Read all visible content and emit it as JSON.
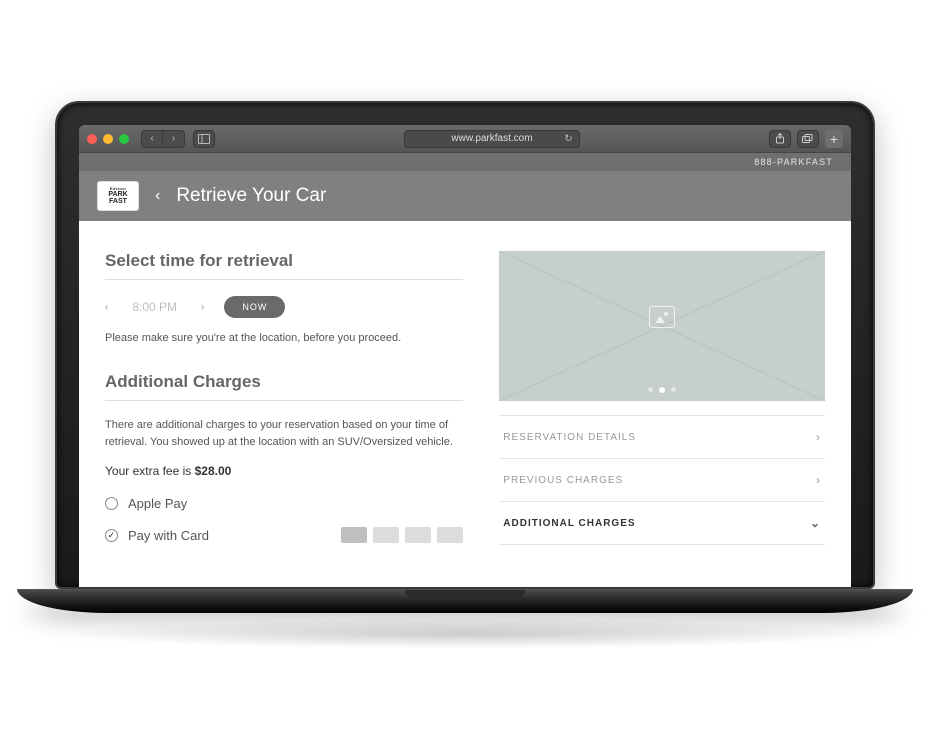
{
  "browser": {
    "url": "www.parkfast.com"
  },
  "topstrip": {
    "phone": "888-PARKFAST"
  },
  "header": {
    "logo_top": "Edison",
    "logo_line1": "PARK",
    "logo_line2": "FAST",
    "title": "Retrieve Your Car"
  },
  "retrieval": {
    "section_title": "Select time for retrieval",
    "time_value": "8:00 PM",
    "now_label": "NOW",
    "hint": "Please make sure you're at the location, before you proceed."
  },
  "charges": {
    "section_title": "Additional Charges",
    "description": "There are additional charges to your reservation based on your time of retrieval. You showed up at the location with an SUV/Oversized vehicle.",
    "fee_prefix": "Your extra fee is ",
    "fee_amount": "$28.00"
  },
  "payment": {
    "options": [
      {
        "label": "Apple Pay",
        "checked": false
      },
      {
        "label": "Pay with Card",
        "checked": true
      }
    ]
  },
  "accordion": {
    "items": [
      {
        "label": "RESERVATION DETAILS",
        "expanded": false
      },
      {
        "label": "PREVIOUS CHARGES",
        "expanded": false
      },
      {
        "label": "ADDITIONAL CHARGES",
        "expanded": true
      }
    ]
  }
}
